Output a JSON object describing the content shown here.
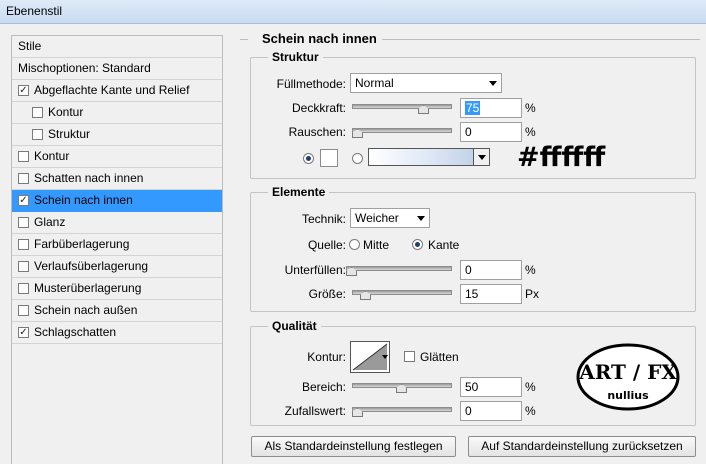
{
  "window": {
    "title": "Ebenenstil"
  },
  "stylelist": {
    "items": [
      {
        "label": "Stile",
        "checkbox": false,
        "checked": false,
        "indent": false,
        "selected": false
      },
      {
        "label": "Mischoptionen: Standard",
        "checkbox": false,
        "checked": false,
        "indent": false,
        "selected": false
      },
      {
        "label": "Abgeflachte Kante und Relief",
        "checkbox": true,
        "checked": true,
        "indent": false,
        "selected": false
      },
      {
        "label": "Kontur",
        "checkbox": true,
        "checked": false,
        "indent": true,
        "selected": false
      },
      {
        "label": "Struktur",
        "checkbox": true,
        "checked": false,
        "indent": true,
        "selected": false
      },
      {
        "label": "Kontur",
        "checkbox": true,
        "checked": false,
        "indent": false,
        "selected": false
      },
      {
        "label": "Schatten nach innen",
        "checkbox": true,
        "checked": false,
        "indent": false,
        "selected": false
      },
      {
        "label": "Schein nach innen",
        "checkbox": true,
        "checked": true,
        "indent": false,
        "selected": true
      },
      {
        "label": "Glanz",
        "checkbox": true,
        "checked": false,
        "indent": false,
        "selected": false
      },
      {
        "label": "Farbüberlagerung",
        "checkbox": true,
        "checked": false,
        "indent": false,
        "selected": false
      },
      {
        "label": "Verlaufsüberlagerung",
        "checkbox": true,
        "checked": false,
        "indent": false,
        "selected": false
      },
      {
        "label": "Musterüberlagerung",
        "checkbox": true,
        "checked": false,
        "indent": false,
        "selected": false
      },
      {
        "label": "Schein nach außen",
        "checkbox": true,
        "checked": false,
        "indent": false,
        "selected": false
      },
      {
        "label": "Schlagschatten",
        "checkbox": true,
        "checked": true,
        "indent": false,
        "selected": false
      }
    ]
  },
  "panel": {
    "heading": "Schein nach innen",
    "struktur": {
      "title": "Struktur",
      "blend_label": "Füllmethode:",
      "blend_value": "Normal",
      "opacity_label": "Deckkraft:",
      "opacity_value": "75",
      "opacity_fraction": 0.75,
      "noise_label": "Rauschen:",
      "noise_value": "0",
      "noise_fraction": 0,
      "percent": "%"
    },
    "elemente": {
      "title": "Elemente",
      "technik_label": "Technik:",
      "technik_value": "Weicher",
      "quelle_label": "Quelle:",
      "quelle_mitte": "Mitte",
      "quelle_kante": "Kante",
      "unterfuellen_label": "Unterfüllen:",
      "unterfuellen_value": "0",
      "unterfuellen_fraction": 0,
      "groesse_label": "Größe:",
      "groesse_value": "15",
      "groesse_unit": "Px",
      "percent": "%"
    },
    "qualitaet": {
      "title": "Qualität",
      "kontur_label": "Kontur:",
      "glaetten_label": "Glätten",
      "bereich_label": "Bereich:",
      "bereich_value": "50",
      "bereich_fraction": 0.5,
      "zufall_label": "Zufallswert:",
      "zufall_value": "0",
      "zufall_fraction": 0,
      "percent": "%"
    },
    "buttons": {
      "set_default": "Als Standardeinstellung festlegen",
      "reset_default": "Auf Standardeinstellung zurücksetzen"
    },
    "annotation": "#ffffff",
    "logo_text": {
      "top": "ART / FX",
      "bottom": "nullius"
    }
  },
  "colors": {
    "selection": "#3399ff",
    "panel_bg": "#f0f0f0"
  }
}
